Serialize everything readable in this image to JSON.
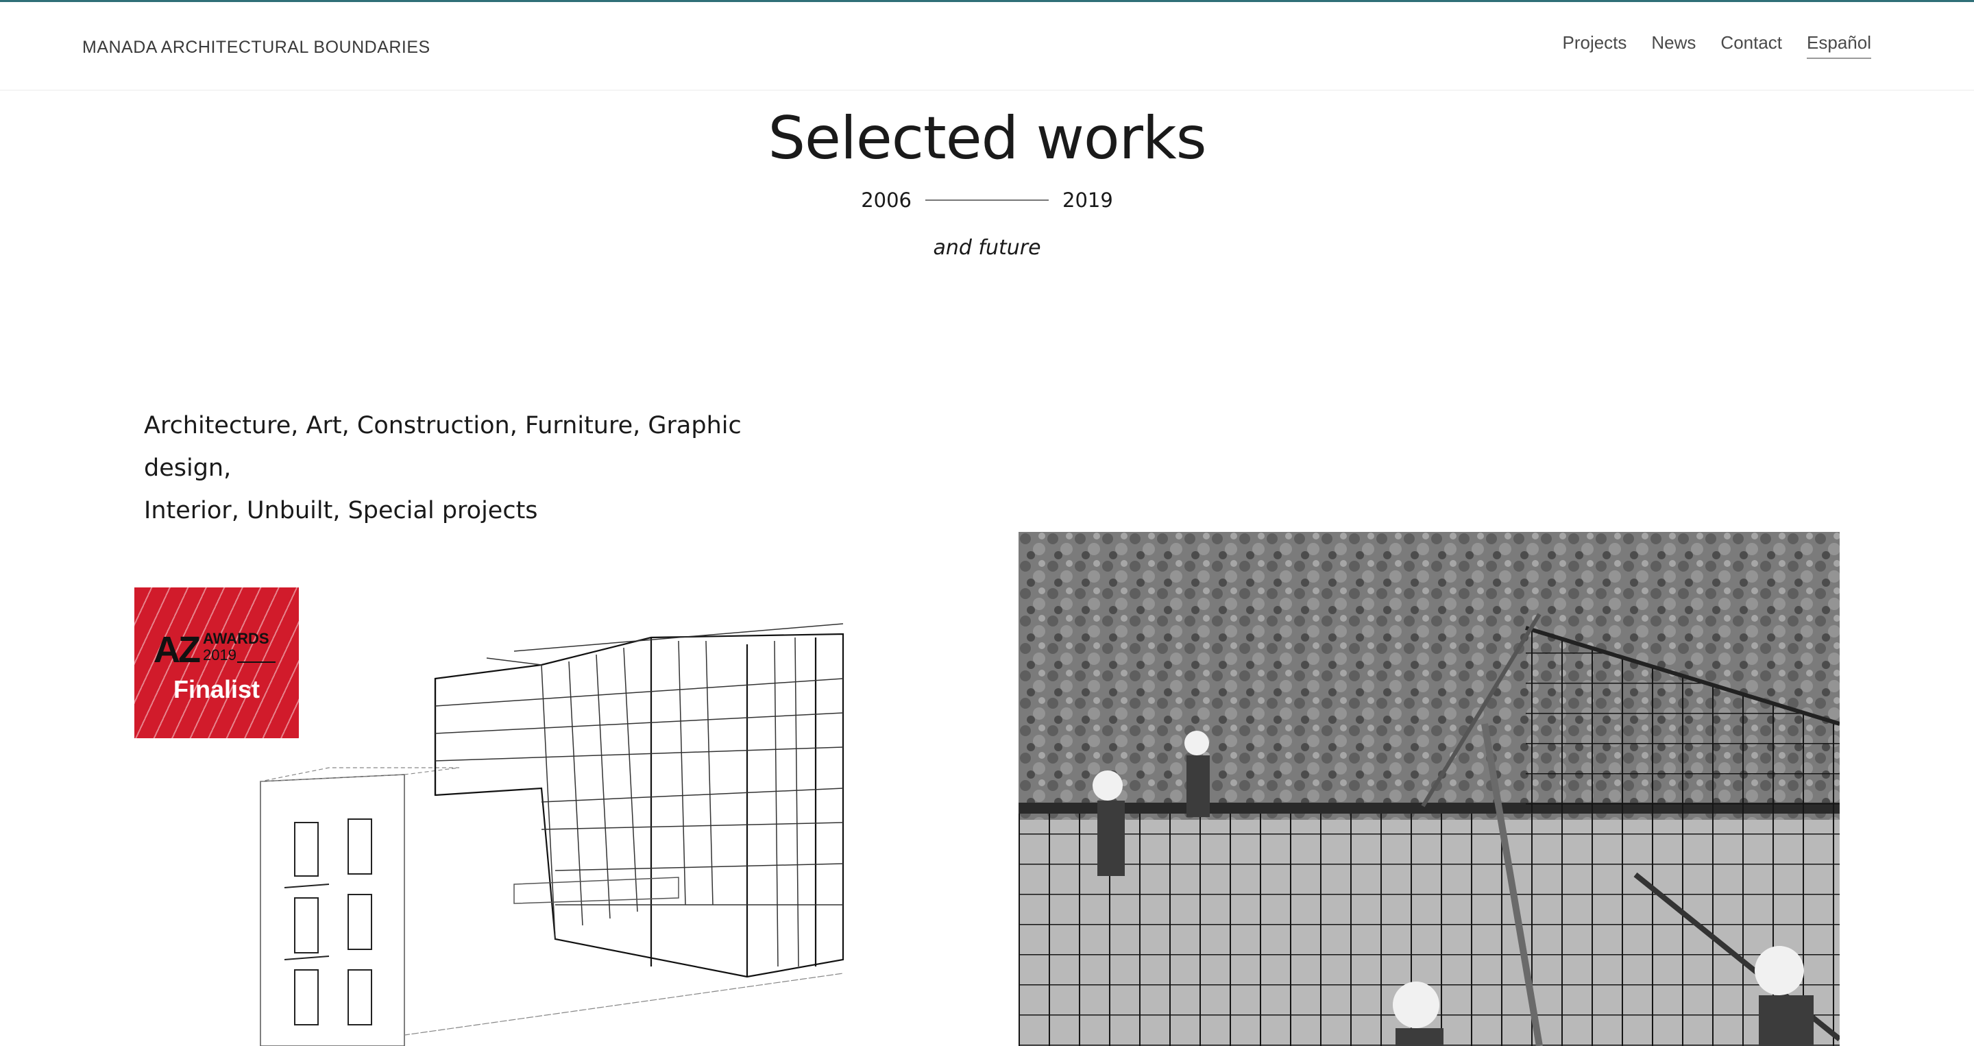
{
  "header": {
    "brand": "MANADA ARCHITECTURAL BOUNDARIES",
    "nav": [
      {
        "label": "Projects"
      },
      {
        "label": "News"
      },
      {
        "label": "Contact"
      },
      {
        "label": "Español"
      }
    ]
  },
  "hero": {
    "title": "Selected works",
    "year_start": "2006",
    "year_end": "2019",
    "tagline": "and future"
  },
  "categories": {
    "items": [
      "Architecture",
      "Art",
      "Construction",
      "Furniture",
      "Graphic design",
      "Interior",
      "Unbuilt",
      "Special projects"
    ]
  },
  "badge": {
    "az": "AZ",
    "awards": "AWARDS",
    "year": "2019",
    "status": "Finalist"
  },
  "colors": {
    "accent_line": "#2f6f77",
    "badge_red": "#d11b2b"
  }
}
